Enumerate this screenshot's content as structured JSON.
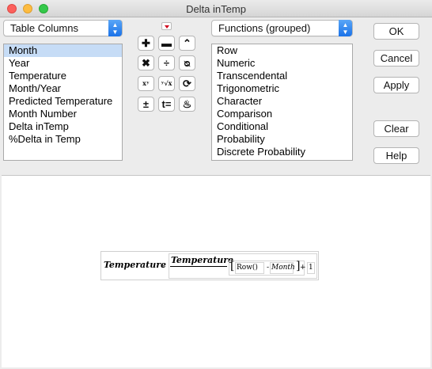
{
  "window": {
    "title": "Delta inTemp"
  },
  "columns_popup": {
    "value": "Table Columns"
  },
  "columns_list": [
    "Month",
    "Year",
    "Temperature",
    "Month/Year",
    "Predicted Temperature",
    "Month Number",
    "Delta inTemp",
    "%Delta in Temp"
  ],
  "functions_popup": {
    "value": "Functions (grouped)"
  },
  "functions_list": [
    "Row",
    "Numeric",
    "Transcendental",
    "Trigonometric",
    "Character",
    "Comparison",
    "Conditional",
    "Probability",
    "Discrete Probability"
  ],
  "operators": [
    {
      "name": "add-button",
      "label": "✚",
      "icon": "plus-icon"
    },
    {
      "name": "subtract-button",
      "label": "▬",
      "icon": "minus-icon"
    },
    {
      "name": "raise-button",
      "label": "⌃",
      "icon": "caret-up-icon"
    },
    {
      "name": "multiply-button",
      "label": "✖",
      "icon": "multiply-icon"
    },
    {
      "name": "divide-button",
      "label": "÷",
      "icon": "divide-icon"
    },
    {
      "name": "assign-button",
      "label": "ᴓ",
      "icon": "assign-icon"
    },
    {
      "name": "power-button",
      "label": "xʸ",
      "icon": "power-icon"
    },
    {
      "name": "root-button",
      "label": "ʸ√x",
      "icon": "root-icon"
    },
    {
      "name": "swap-button",
      "label": "⟳",
      "icon": "swap-icon"
    },
    {
      "name": "negate-button",
      "label": "±",
      "icon": "negate-icon"
    },
    {
      "name": "equals-button",
      "label": "t=",
      "icon": "local-assign-icon"
    },
    {
      "name": "peel-button",
      "label": "♨",
      "icon": "peel-icon"
    }
  ],
  "buttons": {
    "ok": "OK",
    "cancel": "Cancel",
    "apply": "Apply",
    "clear": "Clear",
    "help": "Help"
  },
  "formula": {
    "term1": "Temperature",
    "minus1": "-",
    "term2": "Temperature",
    "row_fn": "Row()",
    "minus2": "-",
    "month": "Month",
    "plus": "+",
    "one": "1"
  },
  "colors": {
    "accent": "#1a72e8",
    "selection": "#c6dcf6",
    "insert_arrow": "#d0021b"
  }
}
